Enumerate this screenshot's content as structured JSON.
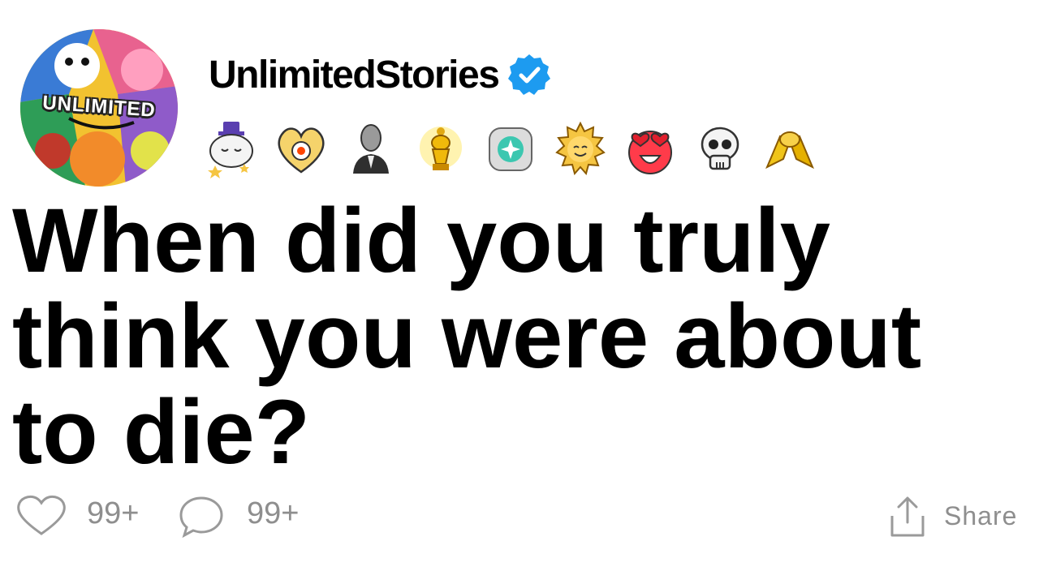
{
  "post": {
    "avatar_text": "UNLIMITED",
    "username": "UnlimitedStories",
    "verified_icon": "verified-check-icon",
    "award_icons": [
      "sleeping-star-award-icon",
      "heart-award-icon",
      "bust-statue-award-icon",
      "gold-trophy-award-icon",
      "gem-award-icon",
      "sun-award-icon",
      "heart-eyes-award-icon",
      "skull-award-icon",
      "handshake-award-icon"
    ],
    "title": "When did you truly think you were about to die?"
  },
  "actions": {
    "likes": "99+",
    "comments": "99+",
    "share_label": "Share"
  },
  "colors": {
    "verified": "#1d9bf0",
    "muted": "#8e8e8e",
    "text": "#000000"
  }
}
